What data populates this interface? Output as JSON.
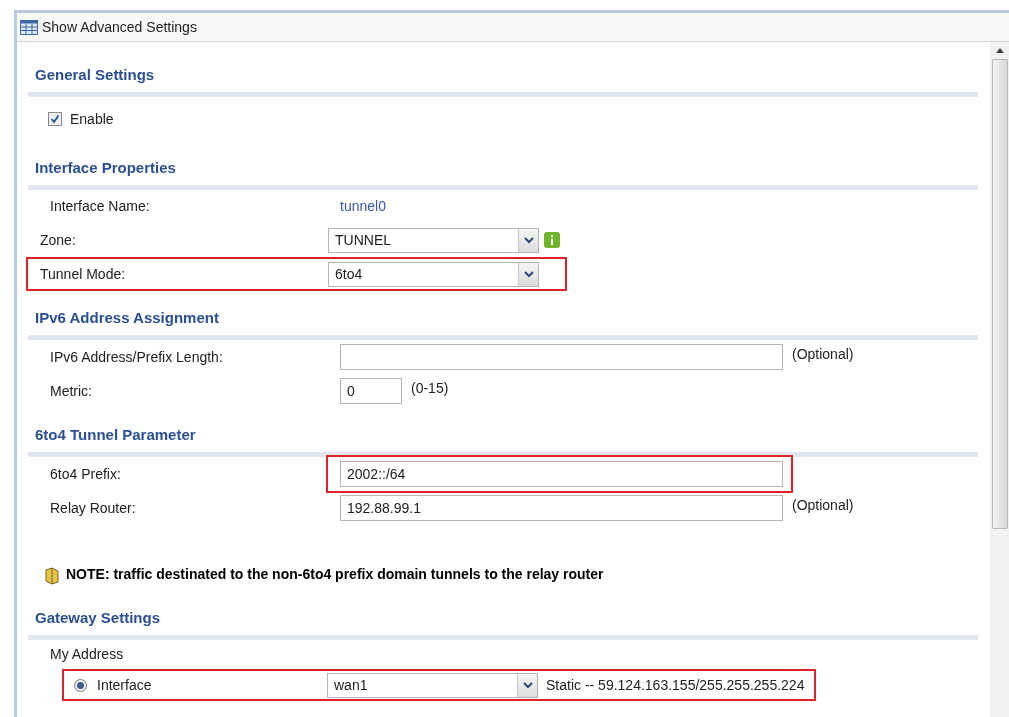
{
  "header": {
    "title": "Show Advanced Settings"
  },
  "sections": [
    {
      "title": "General Settings",
      "rows": [
        {
          "kind": "checkbox",
          "label": "Enable",
          "checked": true
        }
      ]
    },
    {
      "title": "Interface Properties",
      "rows": [
        {
          "kind": "text",
          "label": "Interface Name:",
          "value": "tunnel0"
        },
        {
          "kind": "select",
          "label": "Zone:",
          "value": "TUNNEL",
          "info": true,
          "highlighted": false
        },
        {
          "kind": "select",
          "label": "Tunnel Mode:",
          "value": "6to4",
          "info": false,
          "highlighted": true
        }
      ]
    },
    {
      "title": "IPv6 Address Assignment",
      "rows": [
        {
          "kind": "input",
          "label": "IPv6 Address/Prefix Length:",
          "value": "",
          "hint": "(Optional)",
          "highlighted": false
        },
        {
          "kind": "short-input",
          "label": "Metric:",
          "value": "0",
          "hint": "(0-15)",
          "highlighted": false
        }
      ]
    },
    {
      "title": "6to4 Tunnel Parameter",
      "rows": [
        {
          "kind": "input",
          "label": "6to4 Prefix:",
          "value": "2002::/64",
          "highlighted": true
        },
        {
          "kind": "input",
          "label": "Relay Router:",
          "value": "192.88.99.1",
          "hint": "(Optional)",
          "highlighted": false
        },
        {
          "kind": "note",
          "text": "NOTE: traffic destinated to the non-6to4 prefix domain tunnels to the relay router"
        }
      ]
    },
    {
      "title": "Gateway Settings",
      "rows": [
        {
          "kind": "label",
          "label": "My Address"
        },
        {
          "kind": "radio-select",
          "label": "Interface",
          "selected": true,
          "value": "wan1",
          "detail": "Static -- 59.124.163.155/255.255.255.224",
          "highlighted": true
        }
      ]
    }
  ]
}
